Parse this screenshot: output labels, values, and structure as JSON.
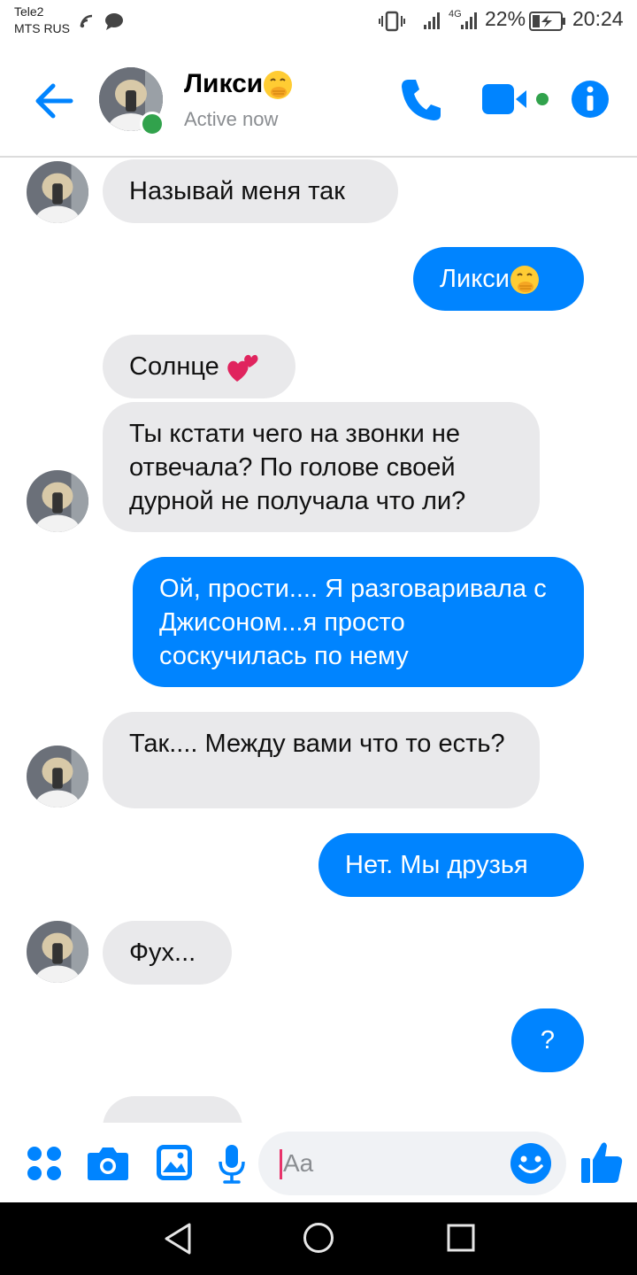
{
  "status_bar": {
    "carrier_line1": "Tele2",
    "carrier_line2": "MTS RUS",
    "network": "4G",
    "battery": "22%",
    "time": "20:24"
  },
  "header": {
    "contact_name": "Ликси",
    "contact_status": "Active now",
    "icons": [
      "back-arrow-icon",
      "phone-icon",
      "video-camera-icon",
      "info-icon"
    ],
    "accent": "#0084ff",
    "online_color": "#31a24c"
  },
  "messages": [
    {
      "from": "contact",
      "text": "Называй меня так"
    },
    {
      "from": "me",
      "text": "Ликси"
    },
    {
      "from": "contact",
      "text": "Солнце"
    },
    {
      "from": "contact",
      "text": "Ты кстати чего на звонки не отвечала? По голове своей дурной не получала что ли?"
    },
    {
      "from": "me",
      "text": "Ой, прости.... Я разговаривала с Джисоном...я просто соскучилась по нему"
    },
    {
      "from": "contact",
      "text": "Так.... Между вами что то есть?"
    },
    {
      "from": "me",
      "text": "Нет. Мы друзья"
    },
    {
      "from": "contact",
      "text": "Фух..."
    },
    {
      "from": "me",
      "text": "?"
    }
  ],
  "composer": {
    "placeholder": "Aa",
    "icons": [
      "apps-grid-icon",
      "camera-icon",
      "gallery-icon",
      "microphone-icon",
      "smiley-icon",
      "like-thumb-icon"
    ]
  },
  "colors": {
    "incoming_bubble": "#e9e9eb",
    "outgoing_bubble": "#0084ff"
  }
}
